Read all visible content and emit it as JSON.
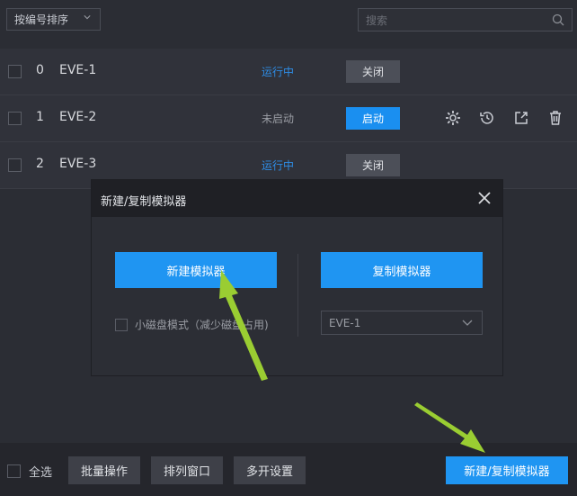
{
  "sort": {
    "label": "按编号排序"
  },
  "search": {
    "placeholder": "搜索"
  },
  "emulators": [
    {
      "index": "0",
      "name": "EVE-1",
      "status": "运行中",
      "action": "关闭"
    },
    {
      "index": "1",
      "name": "EVE-2",
      "status": "未启动",
      "action": "启动"
    },
    {
      "index": "2",
      "name": "EVE-3",
      "status": "运行中",
      "action": "关闭"
    }
  ],
  "dialog": {
    "title": "新建/复制模拟器",
    "new_label": "新建模拟器",
    "copy_label": "复制模拟器",
    "small_disk_label": "小磁盘模式（减少磁盘占用)",
    "source_value": "EVE-1"
  },
  "footer": {
    "select_all": "全选",
    "batch": "批量操作",
    "arrange": "排列窗口",
    "multi_settings": "多开设置",
    "new_copy": "新建/复制模拟器"
  },
  "colors": {
    "accent": "#1f95f2",
    "arrow": "#9acd32",
    "running": "#2e8de6"
  },
  "icons": [
    "chevron-down-icon",
    "search-icon",
    "gear-icon",
    "history-icon",
    "export-icon",
    "trash-icon",
    "close-icon"
  ]
}
